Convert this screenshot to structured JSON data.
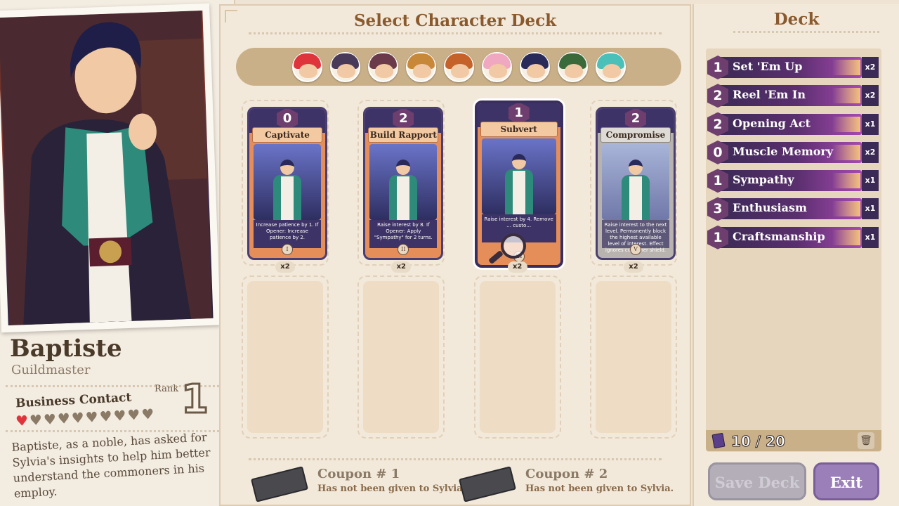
{
  "profile": {
    "name": "Baptiste",
    "title": "Guildmaster",
    "relationship": "Business Contact",
    "rank_label": "Rank",
    "rank_value": "1",
    "hearts_total": 10,
    "hearts_filled": 1,
    "description": "Baptiste, as a noble, has asked for Sylvia's insights to help him better understand the commoners in his employ."
  },
  "center": {
    "title": "Select Character Deck",
    "characters": [
      {
        "icon": "red-hair-character-icon",
        "hair": "#e0343c"
      },
      {
        "icon": "owl-wizard-character-icon",
        "hair": "#4a3a5a"
      },
      {
        "icon": "horned-character-icon",
        "hair": "#6a3a4a"
      },
      {
        "icon": "beard-character-icon",
        "hair": "#c8883a"
      },
      {
        "icon": "orange-hair-character-icon",
        "hair": "#c4622a"
      },
      {
        "icon": "pink-character-icon",
        "hair": "#f0a8c0"
      },
      {
        "icon": "baptiste-character-icon",
        "hair": "#2a2a5a"
      },
      {
        "icon": "green-cap-character-icon",
        "hair": "#3a6a3a"
      },
      {
        "icon": "teal-hair-character-icon",
        "hair": "#4ac0b8"
      }
    ],
    "cards": [
      {
        "cost": "0",
        "name": "Captivate",
        "text": "Increase patience by 1. If Opener: Increase patience by 2.",
        "rank": "I",
        "count": "x2",
        "style": "normal"
      },
      {
        "cost": "2",
        "name": "Build Rapport",
        "text": "Raise interest by 8. If Opener: Apply \"Sympathy\" for 2 turns.",
        "rank": "II",
        "count": "x2",
        "style": "normal"
      },
      {
        "cost": "1",
        "name": "Subvert",
        "text": "Raise interest by 4. Remove … custo…",
        "rank": "III",
        "count": "x2",
        "style": "selected"
      },
      {
        "cost": "2",
        "name": "Compromise",
        "text": "Raise interest to the next level. Permanently block the highest available level of interest. Effect ignores customer shield.",
        "rank": "V",
        "count": "x2",
        "style": "gray"
      }
    ],
    "coupons": [
      {
        "name": "Coupon # 1",
        "desc": "Has not been given to Sylvia."
      },
      {
        "name": "Coupon # 2",
        "desc": "Has not been given to Sylvia."
      }
    ]
  },
  "deck": {
    "title": "Deck",
    "items": [
      {
        "cost": "1",
        "name": "Set 'Em Up",
        "qty": "x2"
      },
      {
        "cost": "2",
        "name": "Reel 'Em In",
        "qty": "x2"
      },
      {
        "cost": "2",
        "name": "Opening Act",
        "qty": "x1"
      },
      {
        "cost": "0",
        "name": "Muscle Memory",
        "qty": "x2"
      },
      {
        "cost": "1",
        "name": "Sympathy",
        "qty": "x1"
      },
      {
        "cost": "3",
        "name": "Enthusiasm",
        "qty": "x1"
      },
      {
        "cost": "1",
        "name": "Craftsmanship",
        "qty": "x1"
      }
    ],
    "count": "10 / 20",
    "save_label": "Save Deck",
    "exit_label": "Exit"
  }
}
